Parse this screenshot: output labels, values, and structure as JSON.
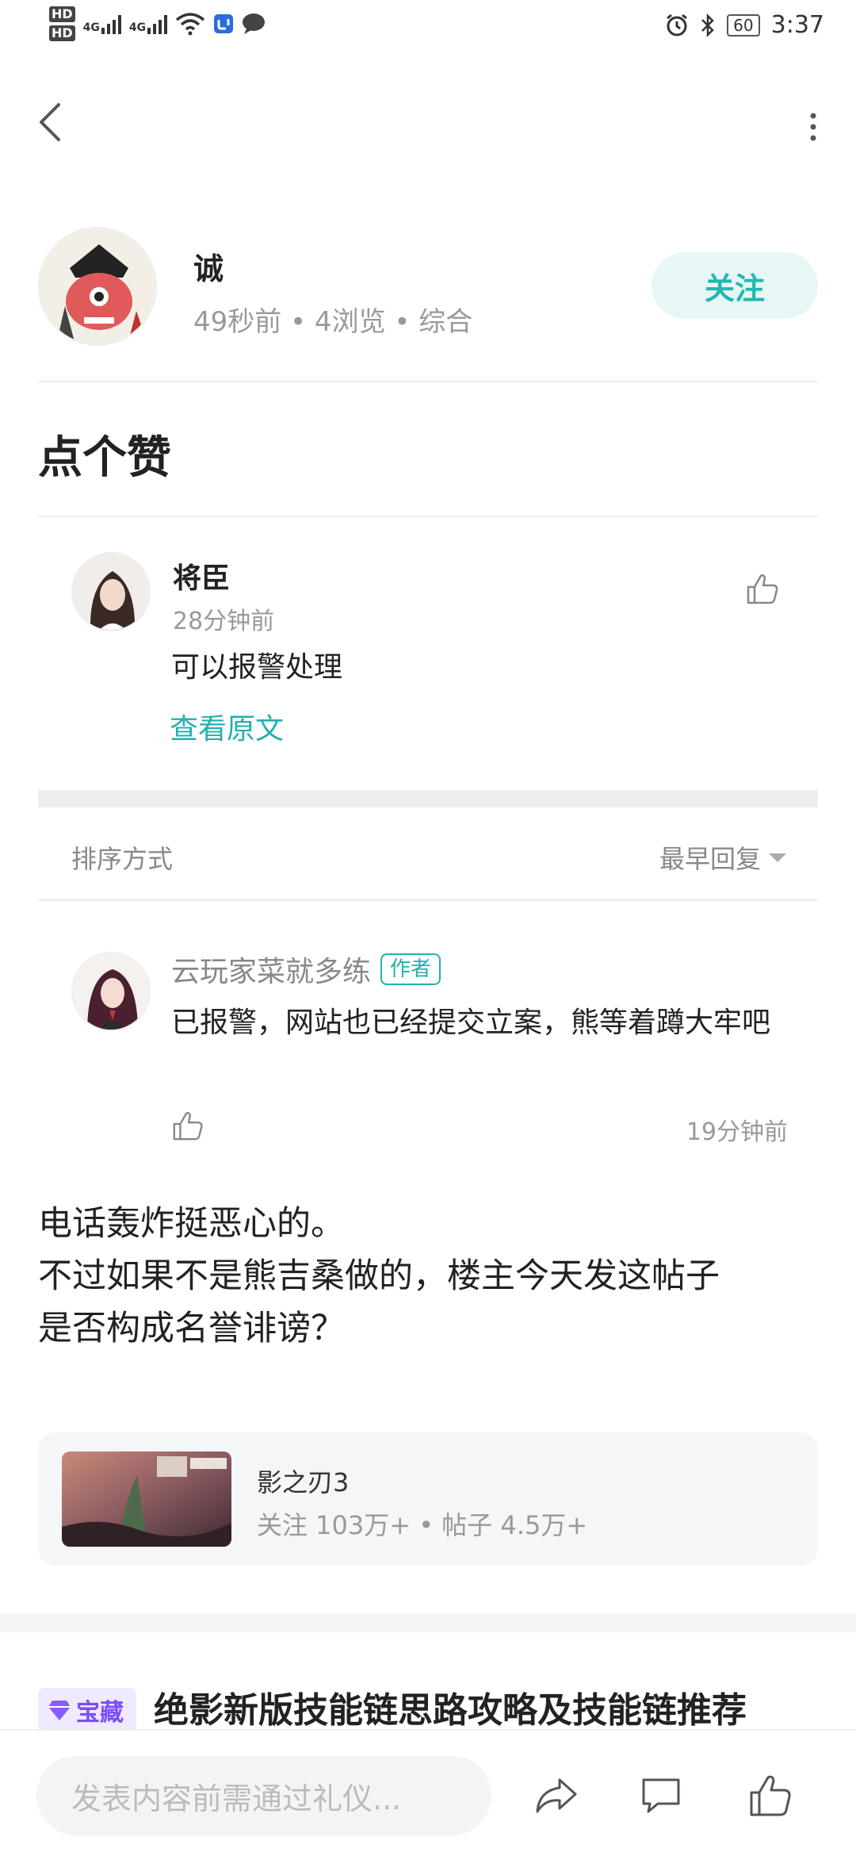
{
  "status_bar": {
    "hd1": "HD",
    "hd2": "HD",
    "sig1": "4G",
    "sig2": "4G",
    "battery": "60",
    "time": "3:37"
  },
  "author": {
    "name": "诚",
    "meta": "49秒前 • 4浏览 • 综合",
    "follow_label": "关注"
  },
  "post": {
    "title": "点个赞",
    "body_lines": [
      "电话轰炸挺恶心的。",
      "不过如果不是熊吉桑做的，楼主今天发这帖子",
      "是否构成名誉诽谤？"
    ]
  },
  "quoted_comment": {
    "name": "将臣",
    "time": "28分钟前",
    "text": "可以报警处理",
    "view_original": "查看原文"
  },
  "sort": {
    "label": "排序方式",
    "value": "最早回复"
  },
  "reply": {
    "name": "云玩家菜就多练",
    "badge": "作者",
    "text": "已报警，网站也已经提交立案，熊等着蹲大牢吧",
    "time": "19分钟前"
  },
  "topic": {
    "name": "影之刃3",
    "stats": "关注 103万+ • 帖子 4.5万+"
  },
  "recommend": {
    "tag": "宝藏",
    "title": "绝影新版技能链思路攻略及技能链推荐"
  },
  "bottom_bar": {
    "input_placeholder": "发表内容前需通过礼仪..."
  },
  "colors": {
    "accent": "#22b8b0",
    "follow_bg": "#e6f7f6",
    "tag_purple": "#7a4dff"
  }
}
